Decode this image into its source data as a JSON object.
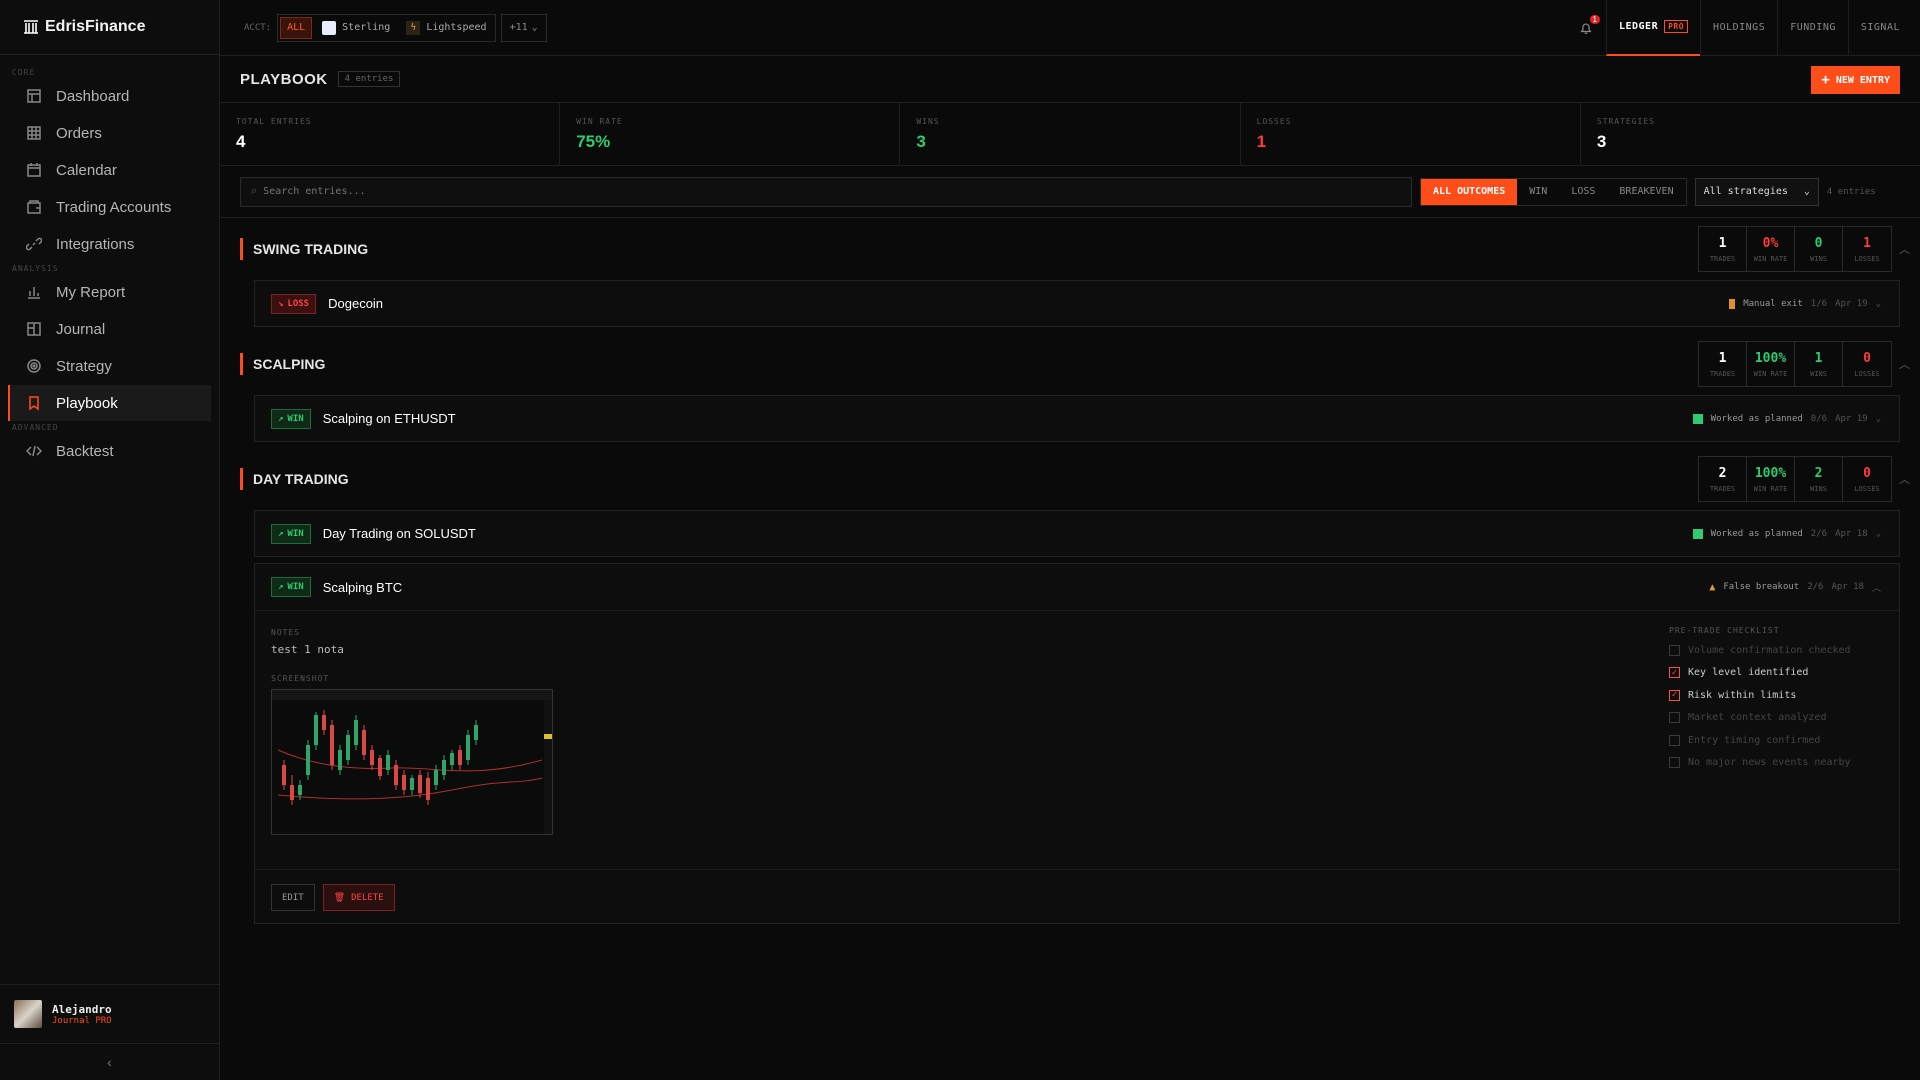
{
  "app": {
    "name": "EdrisFinance"
  },
  "sidebar": {
    "sections": [
      "CORE",
      "ANALYSIS",
      "ADVANCED"
    ],
    "items": [
      {
        "label": "Dashboard",
        "icon": "dashboard-icon"
      },
      {
        "label": "Orders",
        "icon": "grid-icon"
      },
      {
        "label": "Calendar",
        "icon": "calendar-icon"
      },
      {
        "label": "Trading Accounts",
        "icon": "wallet-icon"
      },
      {
        "label": "Integrations",
        "icon": "link-icon"
      },
      {
        "label": "My Report",
        "icon": "bar-chart-icon"
      },
      {
        "label": "Journal",
        "icon": "book-icon"
      },
      {
        "label": "Strategy",
        "icon": "target-icon"
      },
      {
        "label": "Playbook",
        "icon": "bookmark-icon"
      },
      {
        "label": "Backtest",
        "icon": "code-icon"
      }
    ],
    "user": {
      "name": "Alejandro",
      "plan": "Journal PRO"
    },
    "collapse": "‹"
  },
  "topbar": {
    "acct_label": "ACCT:",
    "accounts": [
      {
        "label": "ALL"
      },
      {
        "label": "Sterling"
      },
      {
        "label": "Lightspeed"
      }
    ],
    "more": "+11",
    "notifications": "1",
    "tabs": [
      {
        "label": "LEDGER",
        "badge": "PRO"
      },
      {
        "label": "HOLDINGS"
      },
      {
        "label": "FUNDING"
      },
      {
        "label": "SIGNAL"
      }
    ]
  },
  "playbook": {
    "title": "PLAYBOOK",
    "count": "4 entries",
    "new_entry": "NEW ENTRY",
    "stats": [
      {
        "label": "TOTAL ENTRIES",
        "value": "4"
      },
      {
        "label": "WIN RATE",
        "value": "75%"
      },
      {
        "label": "WINS",
        "value": "3"
      },
      {
        "label": "LOSSES",
        "value": "1"
      },
      {
        "label": "STRATEGIES",
        "value": "3"
      }
    ],
    "search_placeholder": "Search entries...",
    "outcomes": [
      "ALL OUTCOMES",
      "WIN",
      "LOSS",
      "BREAKEVEN"
    ],
    "strategy_select": "All strategies",
    "entries_note": "4 entries",
    "stat_labels": [
      "TRADES",
      "WIN RATE",
      "WINS",
      "LOSSES"
    ],
    "groups": [
      {
        "title": "SWING TRADING",
        "trades": "1",
        "win_rate": "0%",
        "wins": "0",
        "losses": "1",
        "entries": [
          {
            "outcome": "LOSS",
            "name": "Dogecoin",
            "tag": "Manual exit",
            "score": "1/6",
            "date": "Apr 19"
          }
        ]
      },
      {
        "title": "SCALPING",
        "trades": "1",
        "win_rate": "100%",
        "wins": "1",
        "losses": "0",
        "entries": [
          {
            "outcome": "WIN",
            "name": "Scalping on ETHUSDT",
            "tag": "Worked as planned",
            "score": "0/6",
            "date": "Apr 19"
          }
        ]
      },
      {
        "title": "DAY TRADING",
        "trades": "2",
        "win_rate": "100%",
        "wins": "2",
        "losses": "0",
        "entries": [
          {
            "outcome": "WIN",
            "name": "Day Trading on SOLUSDT",
            "tag": "Worked as planned",
            "score": "2/6",
            "date": "Apr 18"
          },
          {
            "outcome": "WIN",
            "name": "Scalping BTC",
            "tag": "False breakout",
            "score": "2/6",
            "date": "Apr 18"
          }
        ]
      }
    ],
    "expanded": {
      "notes_label": "NOTES",
      "notes": "test 1 nota",
      "screenshot_label": "SCREENSHOT",
      "checklist_label": "PRE-TRADE CHECKLIST",
      "checklist": [
        {
          "label": "Volume confirmation checked",
          "checked": false
        },
        {
          "label": "Key level identified",
          "checked": true
        },
        {
          "label": "Risk within limits",
          "checked": true
        },
        {
          "label": "Market context analyzed",
          "checked": false
        },
        {
          "label": "Entry timing confirmed",
          "checked": false
        },
        {
          "label": "No major news events nearby",
          "checked": false
        }
      ],
      "edit": "EDIT",
      "delete": "DELETE"
    }
  },
  "colors": {
    "accent": "#ff4d1a",
    "win": "#2ecc71",
    "loss": "#ff3b3b"
  }
}
